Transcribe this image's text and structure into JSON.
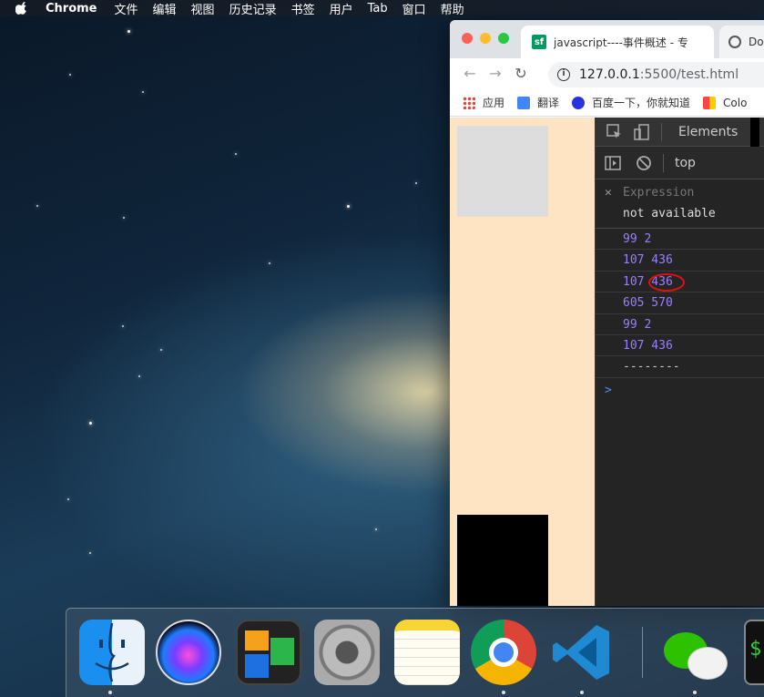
{
  "menubar": {
    "app_name": "Chrome",
    "items": [
      "文件",
      "编辑",
      "视图",
      "历史记录",
      "书签",
      "用户",
      "Tab",
      "窗口",
      "帮助"
    ]
  },
  "browser": {
    "tabs": [
      {
        "favicon": "sf",
        "title": "javascript----事件概述 - 专"
      },
      {
        "title": "Do"
      }
    ],
    "url": {
      "host": "127.0.0.1",
      "rest": ":5500/test.html"
    },
    "bookmarks": [
      "应用",
      "翻译",
      "百度一下，你就知道",
      "Colo"
    ]
  },
  "devtools": {
    "tab_label": "Elements",
    "context": "top",
    "expression": {
      "label": "Expression",
      "value": "not available"
    },
    "logs": [
      "99 2",
      "107 436",
      "107 436",
      "605 570",
      "99 2",
      "107 436",
      "--------"
    ],
    "prompt": ">"
  },
  "dock": {
    "apps": [
      "finder-icon",
      "siri-icon",
      "photo-booth-icon",
      "system-preferences-icon",
      "notes-icon",
      "chrome-icon",
      "vscode-icon",
      "wechat-icon",
      "terminal-icon"
    ]
  }
}
